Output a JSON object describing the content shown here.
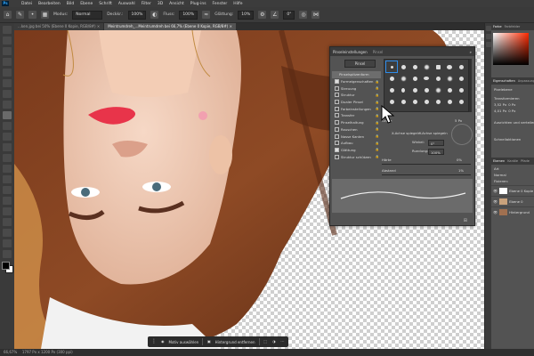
{
  "menubar": {
    "app_logo": "Ps",
    "items": [
      "Datei",
      "Bearbeiten",
      "Bild",
      "Ebene",
      "Schrift",
      "Auswahl",
      "Filter",
      "3D",
      "Ansicht",
      "Plug-ins",
      "Fenster",
      "Hilfe"
    ]
  },
  "options": {
    "mode_label": "Modus:",
    "mode_value": "Normal",
    "opacity_label": "Deckkr.:",
    "opacity_value": "100%",
    "flow_label": "Fluss:",
    "flow_value": "100%",
    "smoothing_label": "Glättung:",
    "smoothing_value": "10%",
    "angle_value": "0°"
  },
  "tabs": [
    {
      "label": "…ken.jpg bei 50% (Ebene 0 Kopie, RGB/8#)",
      "active": false
    },
    {
      "label": "Meintrumdreh_...Meintrumdreh bei 66,7% (Ebene 0 Kopie, RGB/8#)",
      "active": true
    }
  ],
  "brush_panel": {
    "tab_active": "Pinseleinstellungen",
    "tab_inactive": "Pinsel",
    "brushes_button": "Pinsel",
    "items": [
      {
        "label": "Pinselspitzenform",
        "checked": false,
        "highlighted": true
      },
      {
        "label": "Formeigenschaften",
        "checked": true,
        "highlighted": false
      },
      {
        "label": "Streuung",
        "checked": false,
        "highlighted": false
      },
      {
        "label": "Struktur",
        "checked": false,
        "highlighted": false
      },
      {
        "label": "Dualer Pinsel",
        "checked": false,
        "highlighted": false
      },
      {
        "label": "Farbeinstellungen",
        "checked": false,
        "highlighted": false
      },
      {
        "label": "Transfer",
        "checked": false,
        "highlighted": false
      },
      {
        "label": "Pinselhaltung",
        "checked": false,
        "highlighted": false
      },
      {
        "label": "Rauschen",
        "checked": false,
        "highlighted": false
      },
      {
        "label": "Nasse Kanten",
        "checked": false,
        "highlighted": false
      },
      {
        "label": "Aufbau",
        "checked": false,
        "highlighted": false
      },
      {
        "label": "Glättung",
        "checked": true,
        "highlighted": false
      },
      {
        "label": "Struktur schützen",
        "checked": false,
        "highlighted": false
      }
    ],
    "size_label": "Größe",
    "size_value": "5 Px",
    "flip_x": "X-Achse spiegeln",
    "flip_y": "Y-Achse spiegeln",
    "angle_label": "Winkel:",
    "angle_value": "0°",
    "roundness_label": "Rundung:",
    "roundness_value": "100%",
    "hardness_label": "Härte",
    "hardness_value": "0%",
    "spacing_label": "Abstand",
    "spacing_value": "1%"
  },
  "canvas_bar": {
    "select_subject": "Motiv auswählen",
    "remove_bg": "Hintergrund entfernen"
  },
  "status": {
    "zoom": "66,67%",
    "doc": "1797 Px x 1200 Px (300 ppi)"
  },
  "right_panel": {
    "color_tabs": [
      "Farbe",
      "Farbfelder"
    ],
    "props_tabs": [
      "Eigenschaften",
      "Anpassungen"
    ],
    "props_type": "Pixelebene",
    "transform_label": "Transformieren",
    "w_value": "3,52 Px",
    "h_value": "4,01 Px",
    "x_value": "0 Px",
    "y_value": "0 Px",
    "align_label": "Ausrichten und verteilen",
    "quick_label": "Schnellaktionen",
    "layers_tabs": [
      "Ebenen",
      "Kanäle",
      "Pfade"
    ],
    "kind_label": "Art",
    "blend_label": "Normal",
    "lock_label": "Fixieren:",
    "layers": [
      {
        "name": "Ebene 0 Kopie"
      },
      {
        "name": "Ebene 0"
      },
      {
        "name": "Hintergrund"
      }
    ]
  },
  "colors": {
    "app_bg": "#535353",
    "panel_dark": "#3a3a3a",
    "accent": "#2d8ceb"
  }
}
